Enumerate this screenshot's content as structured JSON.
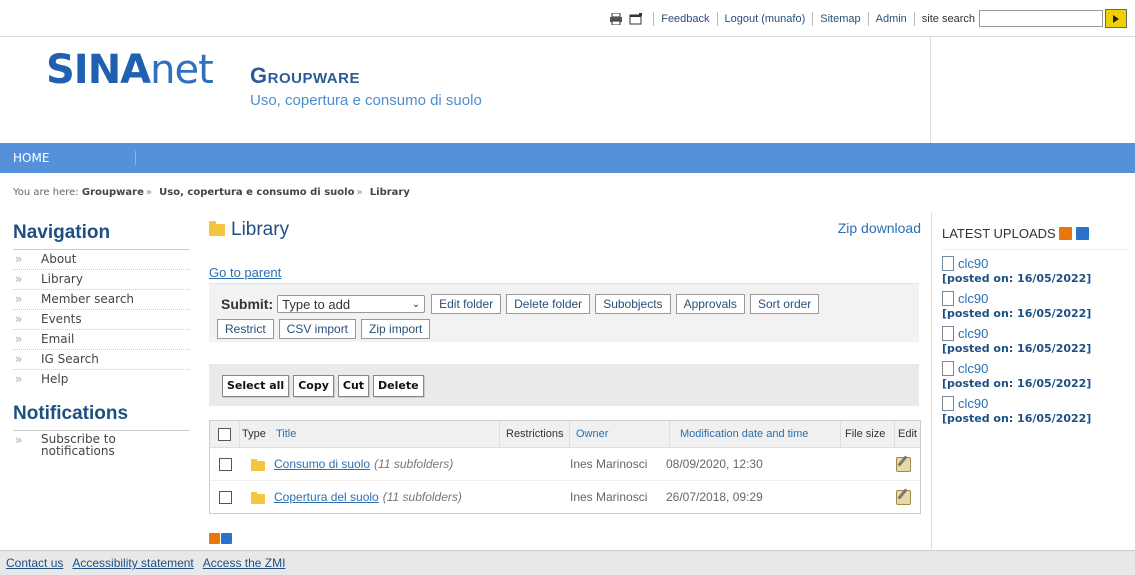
{
  "topbar": {
    "links": [
      "Feedback",
      "Logout (munafo)",
      "Sitemap",
      "Admin"
    ],
    "search_label": "site search",
    "search_value": ""
  },
  "header": {
    "logo_a": "SINA",
    "logo_b": "net",
    "title": "Groupware",
    "subtitle": "Uso, copertura e consumo di suolo"
  },
  "navbar": {
    "home": "HOME"
  },
  "breadcrumb": {
    "prefix": "You are here:",
    "items": [
      "Groupware",
      "Uso, copertura e consumo di suolo",
      "Library"
    ]
  },
  "navigation": {
    "title": "Navigation",
    "items": [
      "About",
      "Library",
      "Member search",
      "Events",
      "Email",
      "IG Search",
      "Help"
    ]
  },
  "notifications": {
    "title": "Notifications",
    "items": [
      "Subscribe to notifications"
    ]
  },
  "main": {
    "title": "Library",
    "zip_download": "Zip download",
    "go_to_parent": "Go to parent",
    "submit_label": "Submit:",
    "submit_select": "Type to add",
    "row1_buttons": [
      "Edit folder",
      "Delete folder",
      "Subobjects",
      "Approvals",
      "Sort order"
    ],
    "row2_buttons": [
      "Restrict",
      "CSV import",
      "Zip import"
    ],
    "actions": [
      "Select all",
      "Copy",
      "Cut",
      "Delete"
    ],
    "table": {
      "headers": [
        "Type",
        "Title",
        "Restrictions",
        "Owner",
        "Modification date and time",
        "File size",
        "Edit"
      ],
      "rows": [
        {
          "title": "Consumo di suolo",
          "note": "(11 subfolders)",
          "owner": "Ines Marinosci",
          "date": "08/09/2020, 12:30"
        },
        {
          "title": "Copertura del suolo",
          "note": "(11 subfolders)",
          "owner": "Ines Marinosci",
          "date": "26/07/2018, 09:29"
        }
      ]
    }
  },
  "latest": {
    "title": "LATEST UPLOADS",
    "items": [
      {
        "name": "clc90",
        "posted": "[posted on: 16/05/2022]"
      },
      {
        "name": "clc90",
        "posted": "[posted on: 16/05/2022]"
      },
      {
        "name": "clc90",
        "posted": "[posted on: 16/05/2022]"
      },
      {
        "name": "clc90",
        "posted": "[posted on: 16/05/2022]"
      },
      {
        "name": "clc90",
        "posted": "[posted on: 16/05/2022]"
      }
    ]
  },
  "footer": {
    "links": [
      "Contact us",
      "Accessibility statement",
      "Access the ZMI"
    ]
  },
  "colors": {
    "navbar": "#5591db",
    "heading": "#1e4f84",
    "link": "#2a6fb0",
    "rss_orange": "#e8770e",
    "folder": "#f5c542"
  }
}
